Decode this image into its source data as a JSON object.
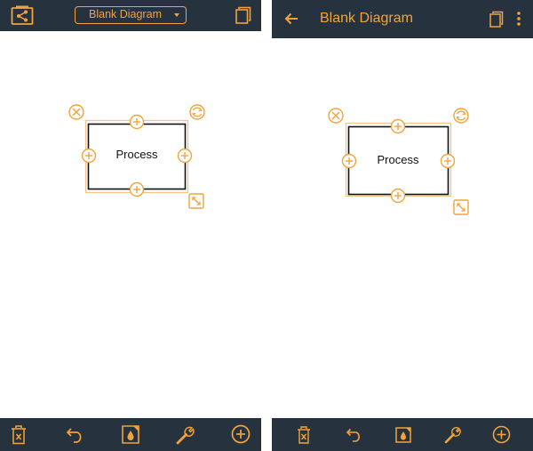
{
  "left": {
    "header": {
      "icon_left": "share-diagram-icon",
      "dropdown_label": "Blank Diagram",
      "dropdown_icon": "caret-down-icon",
      "icon_right": "copy-icon"
    },
    "shape": {
      "label": "Process"
    },
    "toolbar": [
      "trash-icon",
      "undo-icon",
      "fill-color-icon",
      "wrench-icon",
      "add-circle-icon"
    ]
  },
  "right": {
    "header": {
      "back_icon": "arrow-left-icon",
      "title": "Blank Diagram",
      "icon_copy": "copy-icon",
      "icon_more": "more-vert-icon"
    },
    "shape": {
      "label": "Process"
    },
    "toolbar": [
      "trash-icon",
      "undo-icon",
      "fill-color-icon",
      "wrench-icon",
      "add-circle-icon"
    ]
  },
  "colors": {
    "bar": "#27323f",
    "accent": "#f2a33a",
    "selection": "#f0c48a",
    "canvas": "#ffffff",
    "shape_border": "#111111"
  }
}
